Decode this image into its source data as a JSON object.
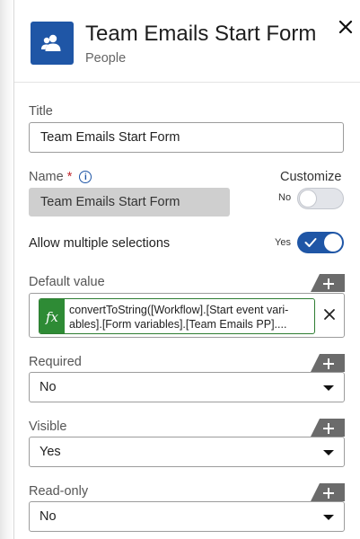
{
  "header": {
    "title": "Team Emails Start Form",
    "subtitle": "People",
    "icon": "people-icon",
    "icon_color": "#1f56a6"
  },
  "fields": {
    "title": {
      "label": "Title",
      "value": "Team Emails Start Form"
    },
    "name": {
      "label": "Name",
      "required_mark": "*",
      "info_icon": "i",
      "value": "Team Emails Start Form"
    },
    "customize": {
      "label": "Customize",
      "state_label": "No",
      "on": false
    },
    "allow_multiple": {
      "label": "Allow multiple selections",
      "state_label": "Yes",
      "on": true
    },
    "default_value": {
      "label": "Default value",
      "fx_label": "fx",
      "expression_line1": "convertToString([Workflow].[Start event vari-",
      "expression_line2": "ables].[Form variables].[Team Emails PP]...."
    },
    "required": {
      "label": "Required",
      "value": "No"
    },
    "visible": {
      "label": "Visible",
      "value": "Yes"
    },
    "read_only": {
      "label": "Read-only",
      "value": "No"
    }
  },
  "colors": {
    "accent": "#1f56a6",
    "fx_green": "#2e8b35",
    "required_star": "#c0282e"
  }
}
